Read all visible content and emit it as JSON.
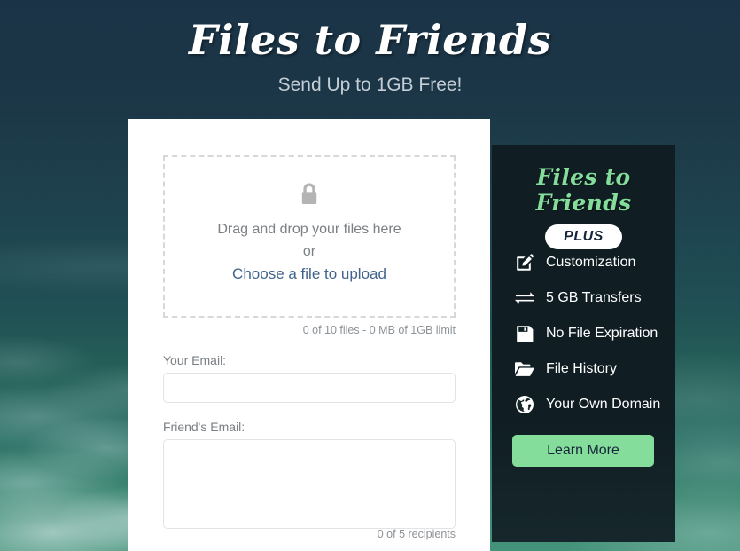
{
  "header": {
    "title": "Files to Friends",
    "tagline": "Send Up to 1GB Free!"
  },
  "upload": {
    "dropzone": {
      "icon": "lock-icon",
      "line1": "Drag and drop your files here",
      "or": "or",
      "choose_link": "Choose a file to upload"
    },
    "file_limit": "0 of 10 files - 0 MB of 1GB limit",
    "your_email_label": "Your Email:",
    "your_email_value": "",
    "your_email_placeholder": "",
    "friend_email_label": "Friend's Email:",
    "friend_email_value": "",
    "friend_email_placeholder": "",
    "recipients_count": "0 of 5 recipients"
  },
  "plus_panel": {
    "title": "Files to Friends",
    "badge": "PLUS",
    "features": [
      {
        "icon": "edit-square-icon",
        "label": "Customization"
      },
      {
        "icon": "exchange-arrows-icon",
        "label": "5 GB Transfers"
      },
      {
        "icon": "floppy-save-icon",
        "label": "No File Expiration"
      },
      {
        "icon": "open-folder-icon",
        "label": "File History"
      },
      {
        "icon": "globe-icon",
        "label": "Your Own Domain"
      }
    ],
    "learn_more": "Learn More"
  },
  "colors": {
    "accent_green": "#85dd9b",
    "panel_dark": "#101e23",
    "link_blue": "#41648b",
    "muted_gray": "#7b8085",
    "sky_top": "#1b3347",
    "sky_bottom": "#45937a"
  }
}
